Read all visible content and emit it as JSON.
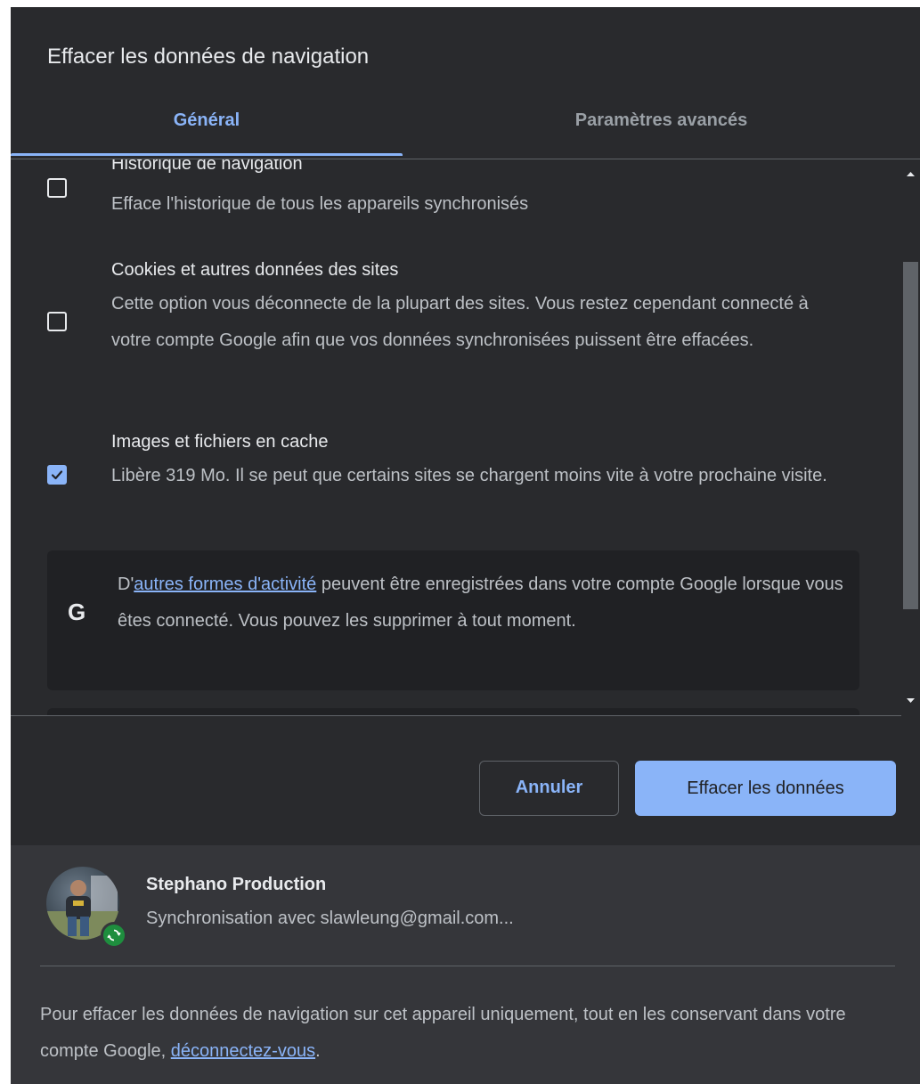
{
  "dialog": {
    "title": "Effacer les données de navigation"
  },
  "tabs": [
    {
      "label": "Général",
      "active": true
    },
    {
      "label": "Paramètres avancés",
      "active": false
    }
  ],
  "items": [
    {
      "title": "Historique de navigation",
      "description": "Efface l'historique de tous les appareils synchronisés",
      "checked": false
    },
    {
      "title": "Cookies et autres données des sites",
      "description": "Cette option vous déconnecte de la plupart des sites. Vous restez cependant connecté à votre compte Google afin que vos données synchronisées puissent être effacées.",
      "checked": false
    },
    {
      "title": "Images et fichiers en cache",
      "description": "Libère 319 Mo. Il se peut que certains sites se chargent moins vite à votre prochaine visite.",
      "checked": true
    }
  ],
  "google_card": {
    "icon": "google-g-icon",
    "text_before": "D'",
    "link": "autres formes d'activité",
    "text_after": " peuvent être enregistrées dans votre compte Google lorsque vous êtes connecté. Vous pouvez les supprimer à tout moment."
  },
  "buttons": {
    "cancel": "Annuler",
    "clear": "Effacer les données"
  },
  "account": {
    "name": "Stephano Production",
    "sync_status": "Synchronisation avec slawleung@gmail.com..."
  },
  "footer_note": {
    "text_before": "Pour effacer les données de navigation sur cet appareil uniquement, tout en les conservant dans votre compte Google, ",
    "link": "déconnectez-vous",
    "text_after": "."
  },
  "colors": {
    "dialog_bg": "#292a2d",
    "footer_bg": "#35363a",
    "accent": "#8ab4f8",
    "card_bg": "#202124",
    "sync_green": "#1e8e3e"
  }
}
